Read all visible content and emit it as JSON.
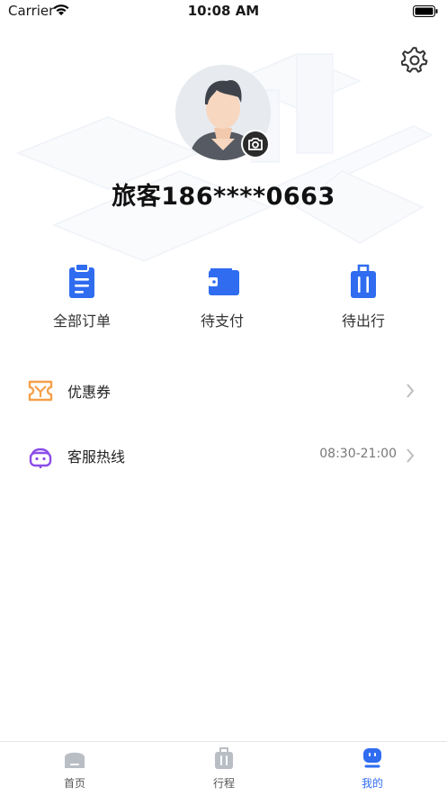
{
  "status_bar": {
    "carrier": "Carrier",
    "time": "10:08 AM"
  },
  "profile": {
    "username": "旅客186****0663"
  },
  "quick_actions": [
    {
      "label": "全部订单",
      "icon": "clipboard-icon"
    },
    {
      "label": "待支付",
      "icon": "wallet-icon"
    },
    {
      "label": "待出行",
      "icon": "luggage-icon"
    }
  ],
  "menu": {
    "coupons": {
      "label": "优惠券",
      "icon": "coupon-icon"
    },
    "support": {
      "label": "客服热线",
      "value": "08:30-21:00",
      "icon": "headset-icon"
    }
  },
  "tabbar": [
    {
      "label": "首页",
      "icon": "home-icon"
    },
    {
      "label": "行程",
      "icon": "trip-icon"
    },
    {
      "label": "我的",
      "icon": "profile-icon",
      "active": true
    }
  ],
  "colors": {
    "accent": "#2f6cf0",
    "coupon": "#f5a04a",
    "support": "#8a4de8"
  }
}
